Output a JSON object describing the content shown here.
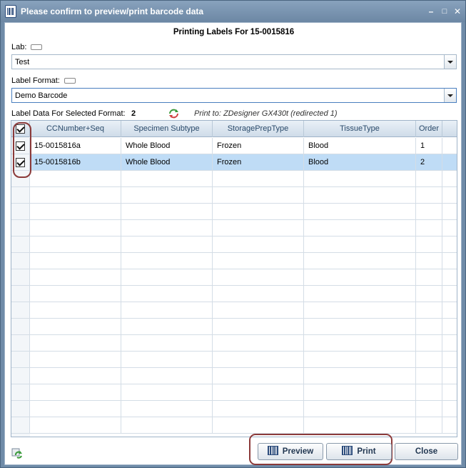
{
  "window": {
    "title": "Please confirm to preview/print barcode data",
    "minimize": "–",
    "maximize": "□",
    "close": "✕"
  },
  "heading": "Printing Labels For 15-0015816",
  "lab": {
    "label": "Lab:",
    "value": "Test"
  },
  "label_format": {
    "label": "Label Format:",
    "value": "Demo Barcode"
  },
  "info": {
    "label": "Label Data For Selected Format:",
    "count": "2",
    "print_to": "Print to: ZDesigner GX430t (redirected 1)"
  },
  "grid": {
    "columns": [
      "CCNumber+Seq",
      "Specimen Subtype",
      "StoragePrepType",
      "TissueType",
      "Order"
    ],
    "rows": [
      {
        "checked": true,
        "cells": [
          "15-0015816a",
          "Whole Blood",
          "Frozen",
          "Blood",
          "1"
        ],
        "selected": false
      },
      {
        "checked": true,
        "cells": [
          "15-0015816b",
          "Whole Blood",
          "Frozen",
          "Blood",
          "2"
        ],
        "selected": true
      }
    ],
    "header_checked": true
  },
  "buttons": {
    "preview": "Preview",
    "print": "Print",
    "close": "Close"
  },
  "icons": {
    "app": "barcode-icon",
    "refresh": "refresh-icon",
    "footer": "refresh-grid-icon"
  },
  "colors": {
    "titlebar": "#7d97b3",
    "selected_row": "#bfdcf6",
    "highlight_circle": "#8b3a3a"
  }
}
